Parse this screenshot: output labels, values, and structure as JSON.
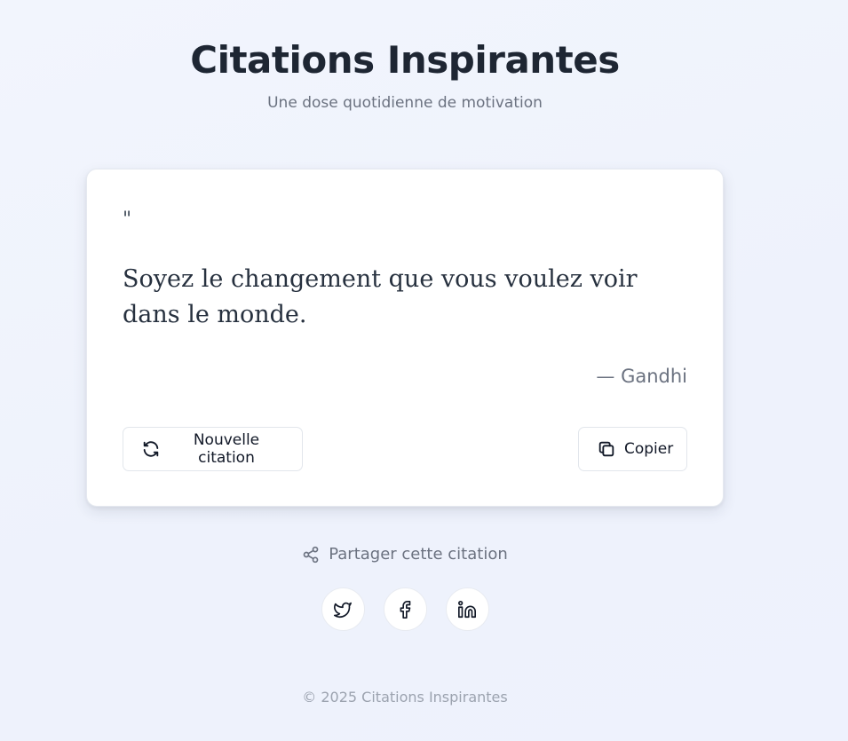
{
  "header": {
    "title": "Citations Inspirantes",
    "subtitle": "Une dose quotidienne de motivation"
  },
  "quote": {
    "mark": "\"",
    "text": "Soyez le changement que vous voulez voir dans le monde.",
    "author": "— Gandhi"
  },
  "actions": {
    "new_label": "Nouvelle citation",
    "new_icon": "refresh-icon",
    "copy_label": "Copier",
    "copy_icon": "copy-icon"
  },
  "share": {
    "label": "Partager cette citation",
    "icon": "share-icon",
    "networks": [
      "twitter-icon",
      "facebook-icon",
      "linkedin-icon"
    ]
  },
  "footer": {
    "text": "© 2025 Citations Inspirantes"
  },
  "colors": {
    "background": "#eef2fc",
    "title": "#1e2633",
    "muted": "#6b7280",
    "card": "#ffffff"
  }
}
